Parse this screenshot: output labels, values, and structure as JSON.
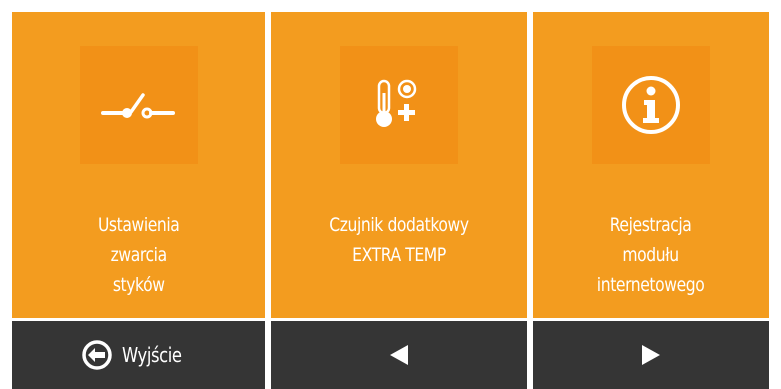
{
  "tiles": [
    {
      "icon": "contact-switch-icon",
      "lines": [
        "Ustawienia",
        "zwarcia",
        "styków"
      ]
    },
    {
      "icon": "thermometer-plus-icon",
      "lines": [
        "Czujnik dodatkowy",
        "EXTRA TEMP"
      ]
    },
    {
      "icon": "info-icon",
      "lines": [
        "Rejestracja",
        "modułu",
        "internetowego"
      ]
    }
  ],
  "bottom_bar": {
    "exit_label": "Wyjście",
    "exit_icon": "exit-arrow-icon",
    "prev_icon": "triangle-left-icon",
    "next_icon": "triangle-right-icon"
  },
  "colors": {
    "tile": "#f39c1f",
    "icon_box": "#f29117",
    "bar": "#353535",
    "text": "#ffffff"
  }
}
